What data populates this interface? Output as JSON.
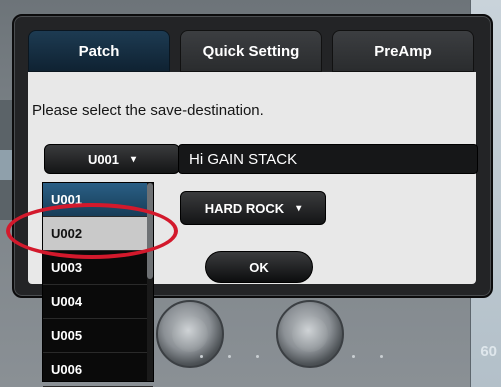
{
  "tabs": [
    {
      "label": "Patch",
      "active": true
    },
    {
      "label": "Quick Setting",
      "active": false
    },
    {
      "label": "PreAmp",
      "active": false
    }
  ],
  "prompt": "Please select the save-destination.",
  "destination": {
    "selected": "U001",
    "caret": "▾"
  },
  "patch_name": {
    "value": "Hi GAIN STACK"
  },
  "genre": {
    "selected": "HARD ROCK",
    "caret": "▾"
  },
  "ok_label": "OK",
  "dropdown": {
    "items": [
      "U001",
      "U002",
      "U003",
      "U004",
      "U005",
      "U006"
    ],
    "current": "U001",
    "highlighted": "U002"
  },
  "background": {
    "right_value": "60"
  },
  "colors": {
    "highlight_ring": "#d3192c",
    "active_tab": "#1d3b52",
    "selected_item": "#2a5f85"
  }
}
